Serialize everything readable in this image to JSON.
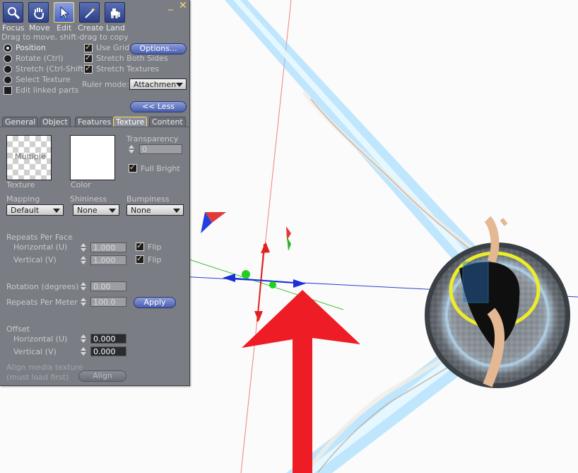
{
  "tools": [
    {
      "label": "Focus",
      "icon": "magnifier-icon"
    },
    {
      "label": "Move",
      "icon": "hand-icon"
    },
    {
      "label": "Edit",
      "icon": "cursor-icon"
    },
    {
      "label": "Create",
      "icon": "wand-icon"
    },
    {
      "label": "Land",
      "icon": "bulldozer-icon"
    }
  ],
  "window": {
    "minimize": "_",
    "close": "✕"
  },
  "hint": "Drag to move, shift-drag to copy",
  "modes": {
    "position": "Position",
    "rotate": "Rotate (Ctrl)",
    "stretch": "Stretch (Ctrl-Shift)",
    "select_texture": "Select Texture",
    "edit_linked": "Edit linked parts"
  },
  "options": {
    "use_grid": "Use Grid",
    "options_button": "Options...",
    "stretch_both": "Stretch Both Sides",
    "stretch_textures": "Stretch Textures",
    "ruler_label": "Ruler mode:",
    "ruler_value": "Attachmen",
    "less_button": "<< Less"
  },
  "tabs": [
    "General",
    "Object",
    "Features",
    "Texture",
    "Content"
  ],
  "texture": {
    "swatch_overlay": "Multiple",
    "texture_label": "Texture",
    "color_label": "Color",
    "transparency_label": "Transparency",
    "transparency_value": "0",
    "full_bright": "Full Bright",
    "mapping_label": "Mapping",
    "mapping_value": "Default",
    "shininess_label": "Shininess",
    "shininess_value": "None",
    "bumpiness_label": "Bumpiness",
    "bumpiness_value": "None",
    "repeats_face_label": "Repeats Per Face",
    "horizontal_u": "Horizontal (U)",
    "vertical_v": "Vertical (V)",
    "repeat_h_value": "1.000",
    "repeat_v_value": "1.000",
    "flip": "Flip",
    "rotation_label": "Rotation (degrees)",
    "rotation_value": "0.00",
    "repeats_meter_label": "Repeats Per Meter",
    "repeats_meter_value": "100.0",
    "apply_button": "Apply",
    "offset_label": "Offset",
    "offset_h_value": "0.000",
    "offset_v_value": "0.000",
    "align_note_1": "Align media texture",
    "align_note_2": "(must load first)",
    "align_button": "Align"
  },
  "colors": {
    "panel_bg": "#7a7d84",
    "highlight": "#ffe060",
    "annotation_arrow": "#ee1c24",
    "axis_x": "#e53030",
    "axis_y": "#30c030",
    "axis_z": "#1a2fd8"
  }
}
